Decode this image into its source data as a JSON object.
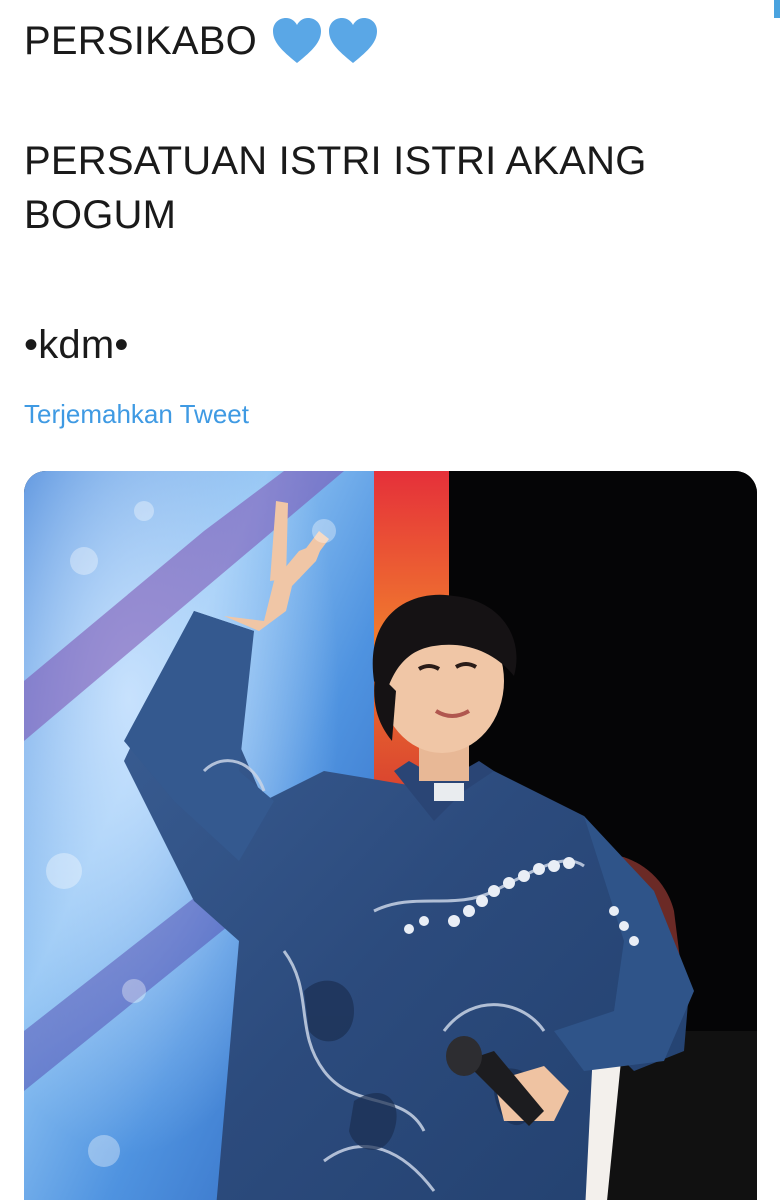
{
  "tweet": {
    "line1": "PERSIKABO",
    "heart_icon": "blue-heart-icon",
    "heart_color": "#5aa7e6",
    "heart_count": 2,
    "line2": "PERSATUAN ISTRI ISTRI AKANG BOGUM",
    "line3": "•kdm•",
    "translate_link": "Terjemahkan Tweet",
    "link_color": "#3f9ae3"
  },
  "media": {
    "kind": "photo",
    "description_icon": "photo"
  }
}
